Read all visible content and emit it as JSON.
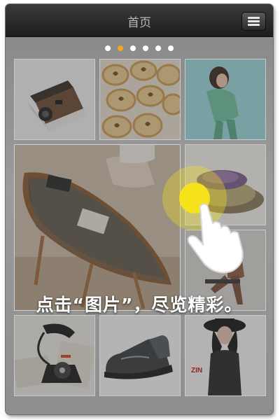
{
  "header": {
    "title": "首页",
    "menu_icon": "hamburger-menu-icon"
  },
  "carousel": {
    "page_count": 6,
    "active_index": 1
  },
  "tiles": [
    {
      "name": "tile-polaroid-camera",
      "subject": "polaroid-camera"
    },
    {
      "name": "tile-cookies",
      "subject": "cookies"
    },
    {
      "name": "tile-model-green",
      "subject": "model-green"
    },
    {
      "name": "tile-boat-table",
      "subject": "boat-table"
    },
    {
      "name": "tile-bowls",
      "subject": "bowls"
    },
    {
      "name": "tile-sitting-man",
      "subject": "sitting-man"
    },
    {
      "name": "tile-telephone",
      "subject": "telephone"
    },
    {
      "name": "tile-shoe",
      "subject": "shoe"
    },
    {
      "name": "tile-woman-hat",
      "subject": "woman-hat"
    }
  ],
  "overlay": {
    "instruction": "点击“图片”，尽览精彩。",
    "hand_icon": "tap-hand-icon"
  },
  "branding": {
    "partial_logo_text": "ZIN"
  },
  "colors": {
    "active_dot": "#f5a623",
    "tap_circle": "#f5e21b",
    "header_bg": "#2a2a2a"
  }
}
